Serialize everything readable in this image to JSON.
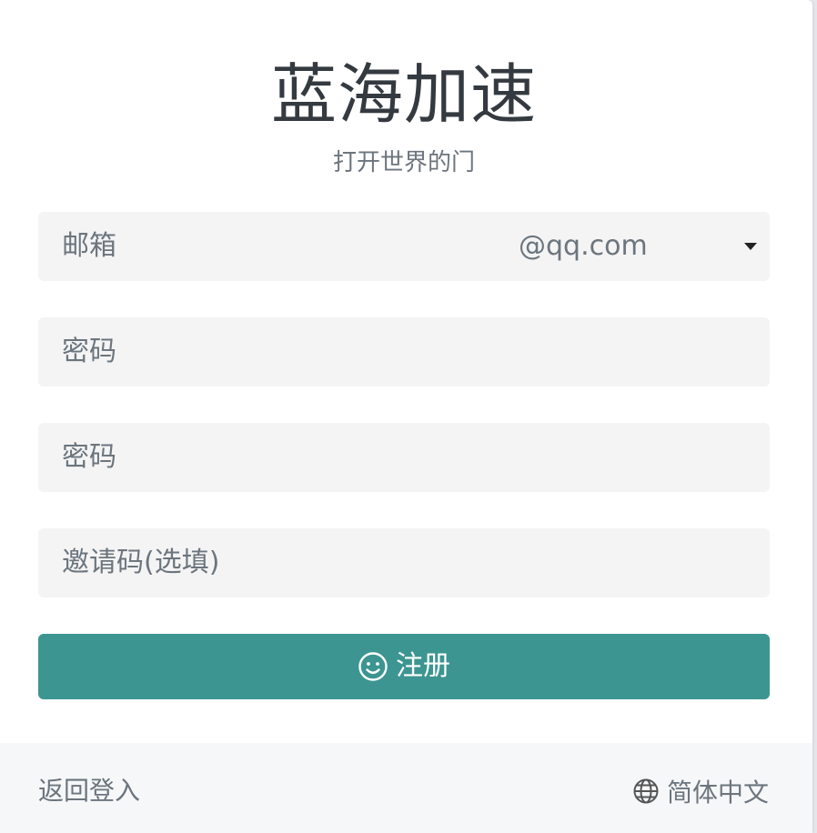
{
  "app": {
    "title": "蓝海加速",
    "subtitle": "打开世界的门"
  },
  "form": {
    "email_placeholder": "邮箱",
    "email_domain": "@qq.com",
    "password_placeholder": "密码",
    "confirm_password_placeholder": "密码",
    "invite_code_placeholder": "邀请码(选填)",
    "register_label": "注册"
  },
  "footer": {
    "back_to_login": "返回登入",
    "language": "简体中文"
  },
  "colors": {
    "accent": "#3c9590",
    "field_background": "#f4f4f5",
    "footer_background": "#f6f7f9"
  },
  "icons": {
    "register": "smile-icon",
    "language": "globe-icon",
    "select": "caret-down-icon"
  }
}
